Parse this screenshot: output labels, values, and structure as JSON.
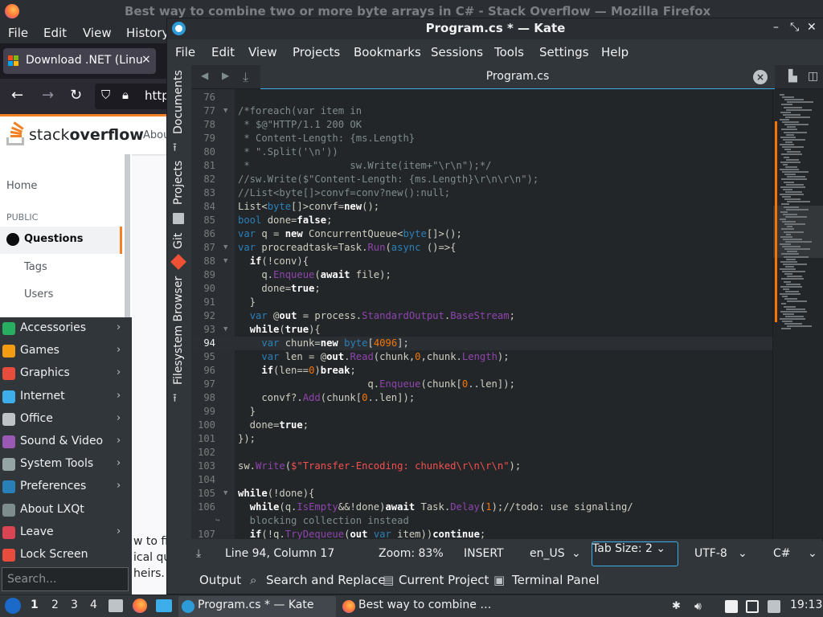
{
  "firefox": {
    "window_title": "Best way to combine two or more byte arrays in C# - Stack Overflow — Mozilla Firefox",
    "menu": [
      "File",
      "Edit",
      "View",
      "History"
    ],
    "tab_label": "Download .NET (Linu",
    "tab_close": "×",
    "url_partial": "http",
    "so_brand_prefix": "stack",
    "so_brand_bold": "overflow",
    "so_about": "Abou",
    "nav": {
      "home": "Home",
      "public": "PUBLIC",
      "questions": "Questions",
      "tags": "Tags",
      "users": "Users"
    },
    "body_lines": [
      "w to fin",
      "ical qu",
      "heirs."
    ]
  },
  "start_menu": {
    "items": [
      {
        "label": "Accessories",
        "submenu": true,
        "color": "#27ae60"
      },
      {
        "label": "Games",
        "submenu": true,
        "color": "#f39c12"
      },
      {
        "label": "Graphics",
        "submenu": true,
        "color": "#e74c3c"
      },
      {
        "label": "Internet",
        "submenu": true,
        "color": "#3daee9"
      },
      {
        "label": "Office",
        "submenu": true,
        "color": "#bdc3c7"
      },
      {
        "label": "Sound & Video",
        "submenu": true,
        "color": "#9b59b6"
      },
      {
        "label": "System Tools",
        "submenu": true,
        "color": "#95a5a6"
      },
      {
        "label": "Preferences",
        "submenu": true,
        "color": "#2980b9"
      },
      {
        "label": "About LXQt",
        "submenu": false,
        "color": "#7f8c8d"
      },
      {
        "label": "Leave",
        "submenu": true,
        "color": "#da4453"
      },
      {
        "label": "Lock Screen",
        "submenu": false,
        "color": "#e74c3c"
      }
    ],
    "search_placeholder": "Search..."
  },
  "kate": {
    "window_title": "Program.cs * — Kate",
    "menu": [
      "File",
      "Edit",
      "View",
      "Projects",
      "Bookmarks",
      "Sessions",
      "Tools",
      "Settings",
      "Help"
    ],
    "side_tabs": [
      "Documents",
      "Projects",
      "Git",
      "Filesystem Browser"
    ],
    "tab_title": "Program.cs",
    "status": {
      "position": "Line 94, Column 17",
      "zoom": "Zoom: 83%",
      "mode": "INSERT",
      "lang": "en_US",
      "tab_size": "Tab Size: 2",
      "encoding": "UTF-8",
      "syntax": "C#"
    },
    "tool_views": [
      "Output",
      "Search and Replace",
      "Current Project",
      "Terminal Panel"
    ],
    "current_line": 94,
    "code_lines": [
      {
        "n": "76",
        "t": ""
      },
      {
        "n": "77",
        "t": "/*foreach(var item in"
      },
      {
        "n": "78",
        "t": " * $@\"HTTP/1.1 200 OK"
      },
      {
        "n": "79",
        "t": " * Content-Length: {ms.Length}"
      },
      {
        "n": "80",
        "t": " * \".Split('\\n'))"
      },
      {
        "n": "81",
        "t": " *                 sw.Write(item+\"\\r\\n\");*/"
      },
      {
        "n": "82",
        "t": "//sw.Write($\"Content-Length: {ms.Length}\\r\\n\\r\\n\");"
      },
      {
        "n": "83",
        "t": "//List<byte[]>convf=conv?new():null;"
      },
      {
        "n": "84",
        "t": "List<byte[]>convf=new();"
      },
      {
        "n": "85",
        "t": "bool done=false;"
      },
      {
        "n": "86",
        "t": "var q = new ConcurrentQueue<byte[]>();"
      },
      {
        "n": "87",
        "t": "var procreadtask=Task.Run(async ()=>{"
      },
      {
        "n": "88",
        "t": "  if(!conv){"
      },
      {
        "n": "89",
        "t": "    q.Enqueue(await file);"
      },
      {
        "n": "90",
        "t": "    done=true;"
      },
      {
        "n": "91",
        "t": "  }"
      },
      {
        "n": "92",
        "t": "  var @out = process.StandardOutput.BaseStream;"
      },
      {
        "n": "93",
        "t": "  while(true){"
      },
      {
        "n": "94",
        "t": "    var chunk=new byte[4096];"
      },
      {
        "n": "95",
        "t": "    var len = @out.Read(chunk,0,chunk.Length);"
      },
      {
        "n": "96",
        "t": "    if(len==0)break;"
      },
      {
        "n": "97",
        "t": "                      q.Enqueue(chunk[0..len]);"
      },
      {
        "n": "98",
        "t": "    convf?.Add(chunk[0..len]);"
      },
      {
        "n": "99",
        "t": "  }"
      },
      {
        "n": "100",
        "t": "  done=true;"
      },
      {
        "n": "101",
        "t": "});"
      },
      {
        "n": "102",
        "t": ""
      },
      {
        "n": "103",
        "t": "sw.Write($\"Transfer-Encoding: chunked\\r\\n\\r\\n\");"
      },
      {
        "n": "104",
        "t": ""
      },
      {
        "n": "105",
        "t": "while(!done){"
      },
      {
        "n": "106",
        "t": "  while(q.IsEmpty&&!done)await Task.Delay(1);//todo: use signaling/"
      },
      {
        "n": "",
        "t": "  blocking collection instead"
      },
      {
        "n": "107",
        "t": "  if(!q.TryDequeue(out var item))continue;"
      }
    ]
  },
  "taskbar": {
    "workspaces": [
      "1",
      "2",
      "3",
      "4"
    ],
    "tasks": [
      "Program.cs * — Kate",
      "Best way to combine …"
    ],
    "clock": "19:13"
  }
}
